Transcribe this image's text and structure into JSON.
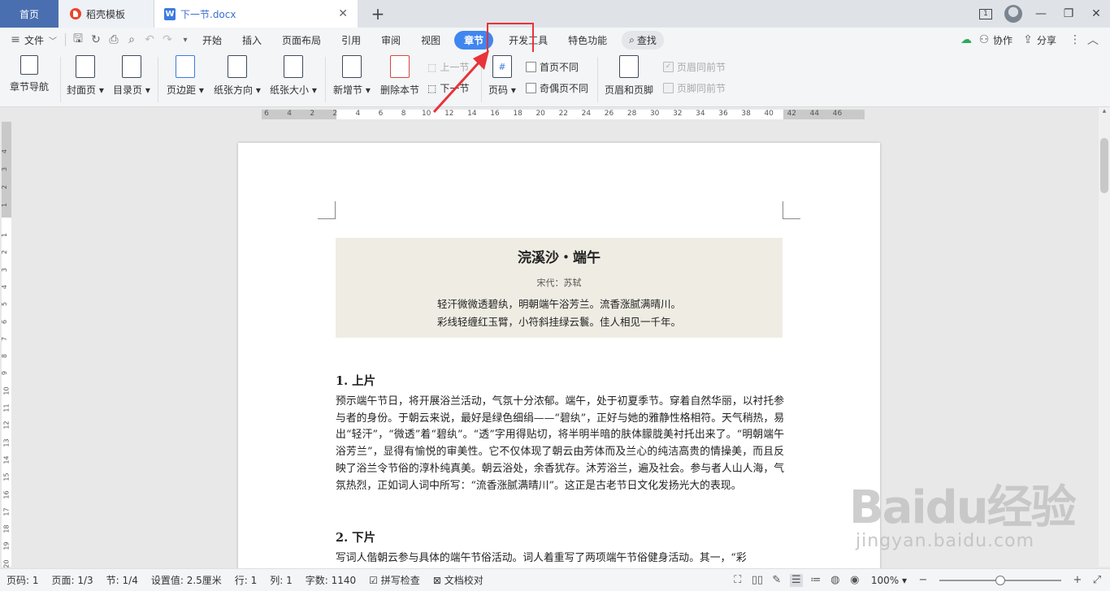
{
  "tabs": {
    "home": "首页",
    "docer": "稻壳模板",
    "document": "下一节.docx",
    "window_badge": "1"
  },
  "menu": {
    "file": "文件",
    "items": [
      "开始",
      "插入",
      "页面布局",
      "引用",
      "审阅",
      "视图",
      "章节",
      "开发工具",
      "特色功能"
    ],
    "search": "查找",
    "collaborate": "协作",
    "share": "分享"
  },
  "ribbon": {
    "chapter_nav": "章节导航",
    "cover": "封面页",
    "toc": "目录页",
    "margins": "页边距",
    "orientation": "纸张方向",
    "paper_size": "纸张大小",
    "new_section": "新增节",
    "delete_section": "删除本节",
    "prev_section": "上一节",
    "next_section": "下一节",
    "page_number": "页码",
    "first_page_diff": "首页不同",
    "odd_even_diff": "奇偶页不同",
    "header_footer": "页眉和页脚",
    "header_same_prev": "页眉同前节",
    "footer_same_prev": "页脚同前节"
  },
  "ruler": {
    "h_ticks": [
      "6",
      "4",
      "2",
      "2",
      "4",
      "6",
      "8",
      "10",
      "12",
      "14",
      "16",
      "18",
      "20",
      "22",
      "24",
      "26",
      "28",
      "30",
      "32",
      "34",
      "36",
      "38",
      "40",
      "42",
      "44",
      "46"
    ],
    "v_ticks_top": [
      "4",
      "3",
      "2",
      "1"
    ],
    "v_ticks_body": [
      "1",
      "2",
      "3",
      "4",
      "5",
      "6",
      "7",
      "8",
      "9",
      "10",
      "11",
      "12",
      "13",
      "14",
      "15",
      "16",
      "17",
      "18",
      "19",
      "20"
    ]
  },
  "document": {
    "poem_title": "浣溪沙・端午",
    "poem_author": "宋代：苏轼",
    "poem_lines": [
      "轻汗微微透碧纨，明朝端午浴芳兰。流香涨腻满晴川。",
      "彩线轻缠红玉臂，小符斜挂绿云鬟。佳人相见一千年。"
    ],
    "heading1": "1.  上片",
    "para1": "预示端午节日，将开展浴兰活动，气氛十分浓郁。端午，处于初夏季节。穿着自然华丽，以衬托参与者的身份。于朝云来说，最好是绿色细绢——“碧纨”，正好与她的雅静性格相符。天气稍热，易出“轻汗”，“微透”着“碧纨”。“透”字用得贴切，将半明半暗的肤体朦胧美衬托出来了。“明朝端午浴芳兰”，显得有愉悦的审美性。它不仅体现了朝云由芳体而及兰心的纯洁高贵的情操美，而且反映了浴兰令节俗的淳朴纯真美。朝云浴处，余香犹存。沐芳浴兰，遍及社会。参与者人山人海，气氛热烈，正如词人词中所写：“流香涨腻满晴川”。这正是古老节日文化发扬光大的表现。",
    "heading2": "2.  下片",
    "para2": "写词人偕朝云参与具体的端午节俗活动。词人着重写了两项端午节俗健身活动。其一，“彩"
  },
  "status": {
    "page_code": "页码: 1",
    "page": "页面: 1/3",
    "section": "节: 1/4",
    "setting": "设置值: 2.5厘米",
    "row": "行: 1",
    "col": "列: 1",
    "word_count": "字数: 1140",
    "spell_check": "拼写检查",
    "proofread": "文档校对",
    "zoom": "100%",
    "zoom_level": 0.5
  },
  "watermark": {
    "logo": "Baidu经验",
    "url": "jingyan.baidu.com"
  },
  "colors": {
    "accent": "#3f86f0",
    "highlight": "#e8333a",
    "home_tab": "#4a6fb0",
    "title_box": "#efede3"
  }
}
